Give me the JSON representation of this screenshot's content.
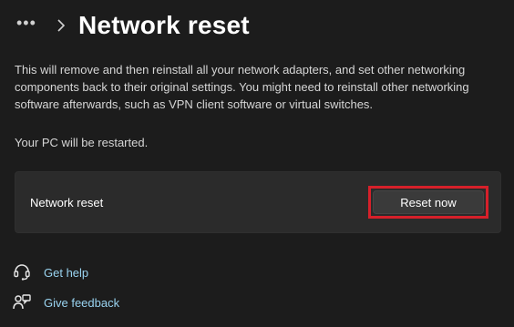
{
  "header": {
    "more_label": "•••",
    "title": "Network reset"
  },
  "main": {
    "description": "This will remove and then reinstall all your network adapters, and set other networking components back to their original settings. You might need to reinstall other networking software afterwards, such as VPN client software or virtual switches.",
    "restart_note": "Your PC will be restarted.",
    "card": {
      "label": "Network reset",
      "button_label": "Reset now"
    }
  },
  "links": [
    {
      "label": "Get help",
      "icon": "help-icon"
    },
    {
      "label": "Give feedback",
      "icon": "feedback-icon"
    }
  ],
  "colors": {
    "background": "#1c1c1c",
    "card": "#2b2b2b",
    "link": "#99d3f0",
    "highlight": "#d6202a"
  }
}
